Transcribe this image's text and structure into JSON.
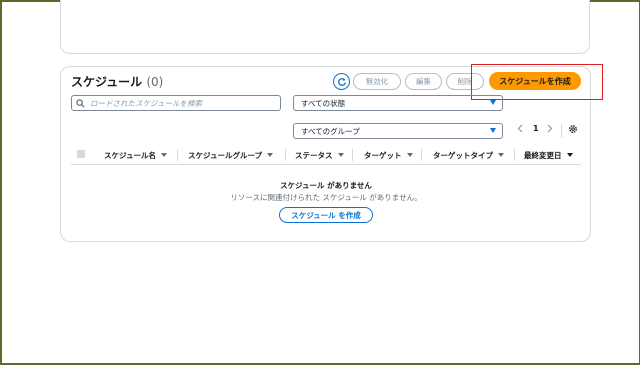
{
  "section": {
    "title": "スケジュール",
    "count": "(0)"
  },
  "toolbar": {
    "disable_label": "無効化",
    "edit_label": "編集",
    "delete_label": "削除",
    "create_label": "スケジュールを作成"
  },
  "search": {
    "placeholder": "ロードされたスケジュールを検索",
    "icon": "search-icon"
  },
  "filters": {
    "state_selected": "すべての状態",
    "group_selected": "すべてのグループ"
  },
  "pagination": {
    "page": "1"
  },
  "table": {
    "columns": [
      "スケジュール名",
      "スケジュールグループ",
      "ステータス",
      "ターゲット",
      "ターゲットタイプ",
      "最終変更日"
    ]
  },
  "empty_state": {
    "title": "スケジュール がありません",
    "subtitle": "リソースに関連付けられた スケジュール がありません。",
    "button_label": "スケジュール を作成"
  },
  "colors": {
    "primary": "#ff9900",
    "link": "#0972d3",
    "highlight": "#e02020"
  }
}
